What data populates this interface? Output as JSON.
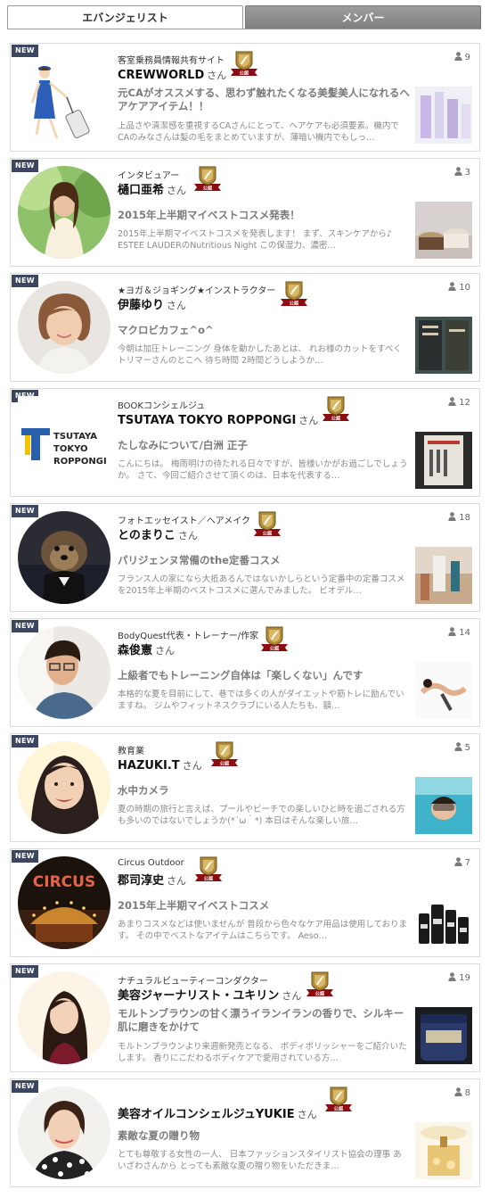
{
  "tabs": {
    "evangelist": "エバンジェリスト",
    "member": "メンバー"
  },
  "badge_new": "NEW",
  "honorific": "さん",
  "official_label": "公認",
  "cards": [
    {
      "role": "客室乗務員情報共有サイト",
      "name": "CREWWORLD",
      "count": "9",
      "title": "元CAがオススメする、思わず触れたくなる美髪美人になれるヘアケアアイテム！！",
      "excerpt": "上品さや清潔感を重視するCAさんにとって、ヘアケアも必須要素。機内でCAのみなさんは髪の毛をまとめていますが、薄暗い機内でもしっ…"
    },
    {
      "role": "インタビュアー",
      "name": "樋口亜希",
      "count": "3",
      "title": "2015年上半期マイベストコスメ発表！",
      "excerpt": "2015年上半期マイベストコスメを発表します！ まず、スキンケアから♪ ESTEE LAUDERのNutritious Night この保湿力、濃密…"
    },
    {
      "role": "★ヨガ＆ジョギング★インストラクター",
      "name": "伊藤ゆり",
      "count": "10",
      "title": "マクロビカフェ^o^",
      "excerpt": "今朝は加圧トレーニング 身体を動かしたあとは、 れお様のカットをすべくトリマーさんのとこへ 待ち時間 2時間どうしようか…"
    },
    {
      "role": "BOOKコンシェルジュ",
      "name": "TSUTAYA TOKYO ROPPONGI",
      "count": "12",
      "logo_text": [
        "TSUTAYA",
        "TOKYO",
        "ROPPONGI"
      ],
      "title": "たしなみについて/白洲 正子",
      "excerpt": "こんにちは。 梅雨明けの待たれる日々ですが、皆様いかがお過ごしでしょうか。 さて、今回ご紹介させて頂くのは、日本を代表する…"
    },
    {
      "role": "フォトエッセイスト／ヘアメイク",
      "name": "とのまりこ",
      "count": "18",
      "title": "パリジェンヌ常備のthe定番コスメ",
      "excerpt": "フランス人の家になら大抵あるんではないかしらという定番中の定番コスメを2015年上半期のベストコスメに選んでみました。 ビオデル…"
    },
    {
      "role": "BodyQuest代表・トレーナー/作家",
      "name": "森俊憲",
      "count": "14",
      "title": "上級者でもトレーニング自体は「楽しくない」んです",
      "excerpt": "本格的な夏を目前にして、巷では多くの人がダイエットや筋トレに励んでいますね。 ジムやフィットネスクラブにいる人たちも、額…"
    },
    {
      "role": "教育業",
      "name": "HAZUKI.T",
      "count": "5",
      "title": "水中カメラ",
      "excerpt": "夏の時期の旅行と言えば、プールやビーチでの楽しいひと時を過ごされる方も多いのではないでしょうか(*´ω｀*) 本日はそんな楽しい旅…"
    },
    {
      "role": "Circus Outdoor",
      "name": "郡司淳史",
      "count": "7",
      "title": "2015年上半期マイベストコスメ",
      "excerpt": "あまりコスメなどは使いませんが 普段から色々なケア用品は使用しております。 その中でベストなアイテムはこちらです。 Aeso…"
    },
    {
      "role": "ナチュラルビューティーコンダクター",
      "name": "美容ジャーナリスト・ユキリン",
      "count": "19",
      "title": "モルトンブラウンの甘く漂うイランイランの香りで、シルキー肌に磨きをかけて",
      "excerpt": "モルトンブラウンより来週新発売となる、 ボディポリッシャーをご紹介いたします。 香りにこだわるボディケアで愛用されている方…"
    },
    {
      "role": "",
      "name": "美容オイルコンシェルジュYUKIE",
      "count": "8",
      "title": "素敵な夏の贈り物",
      "excerpt": "とても尊敬する女性の一人、 日本ファッションスタイリスト協会の理事 あいざわさんから とっても素敵な夏の贈り物をいただきま…"
    }
  ]
}
